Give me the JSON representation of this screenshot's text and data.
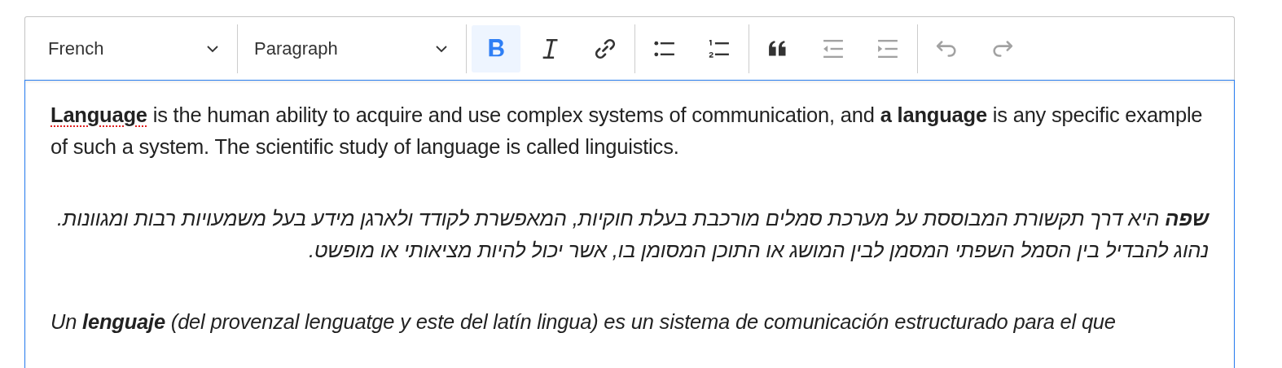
{
  "toolbar": {
    "groups": [
      [
        {
          "kind": "dropdown",
          "value": "French"
        }
      ],
      [
        {
          "kind": "dropdown",
          "value": "Paragraph"
        }
      ],
      [
        {
          "kind": "bold",
          "on": true,
          "disabled": false
        },
        {
          "kind": "italic",
          "on": false,
          "disabled": false
        },
        {
          "kind": "link",
          "on": false,
          "disabled": false
        }
      ],
      [
        {
          "kind": "bulleted-list",
          "on": false,
          "disabled": false
        },
        {
          "kind": "numbered-list",
          "on": false,
          "disabled": false
        }
      ],
      [
        {
          "kind": "blockquote",
          "on": false,
          "disabled": false
        },
        {
          "kind": "outdent",
          "on": false,
          "disabled": true
        },
        {
          "kind": "indent",
          "on": false,
          "disabled": true
        }
      ],
      [
        {
          "kind": "undo",
          "on": false,
          "disabled": true
        },
        {
          "kind": "redo",
          "on": false,
          "disabled": true
        }
      ]
    ]
  },
  "content": {
    "paragraphs": [
      {
        "italic": false,
        "runs": [
          {
            "text": "Language",
            "bold": true,
            "misspelled": true
          },
          {
            "text": " is the human ability to acquire and use complex systems of communication, and ",
            "bold": false,
            "misspelled": false
          },
          {
            "text": "a language",
            "bold": true,
            "misspelled": false
          },
          {
            "text": " is any specific example of such a system. The scientific study of language is called linguistics.",
            "bold": false,
            "misspelled": false
          }
        ]
      },
      {
        "italic": true,
        "runs": [
          {
            "text": "שפה",
            "bold": true,
            "misspelled": false
          },
          {
            "text": " היא דרך תקשורת המבוססת על מערכת סמלים מורכבת בעלת חוקיות, המאפשרת לקודד ולארגן מידע בעל משמעויות רבות ומגוונות. נהוג להבדיל בין הסמל השפתי המסמן לבין המושג או התוכן המסומן בו, אשר יכול להיות מציאותי או מופשט.",
            "bold": false,
            "misspelled": false
          }
        ]
      },
      {
        "italic": true,
        "runs": [
          {
            "text": "Un ",
            "bold": false,
            "misspelled": false
          },
          {
            "text": "lenguaje",
            "bold": true,
            "misspelled": false
          },
          {
            "text": " (del provenzal lenguatge y este del latín lingua) es un sistema de comunicación estructurado para el que",
            "bold": false,
            "misspelled": false
          }
        ]
      }
    ]
  }
}
